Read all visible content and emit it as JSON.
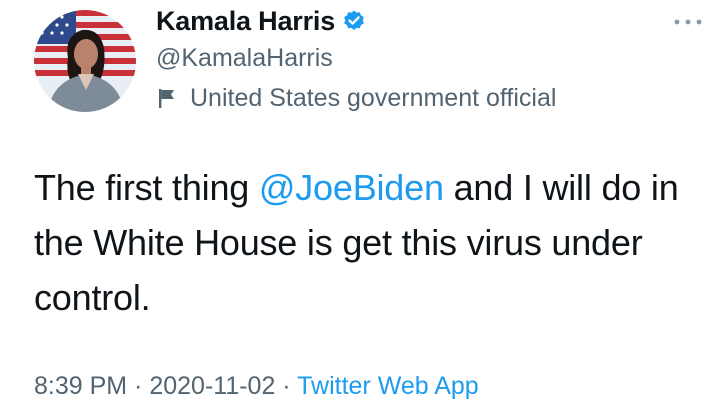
{
  "author": {
    "display_name": "Kamala Harris",
    "handle": "@KamalaHarris",
    "label": "United States government official",
    "verified_icon": "verified-badge-icon",
    "label_icon": "flag-icon"
  },
  "menu": {
    "more_icon": "more-options-icon"
  },
  "tweet": {
    "text_before": "The first thing ",
    "mention": "@JoeBiden",
    "text_after": " and I will do in the White House is get this virus under control."
  },
  "meta": {
    "time": "8:39 PM",
    "sep1": " · ",
    "date": "2020-11-02",
    "sep2": " · ",
    "source": "Twitter Web App"
  },
  "colors": {
    "text": "#0f1419",
    "secondary": "#536471",
    "link": "#1d9bf0",
    "verified": "#1d9bf0"
  }
}
